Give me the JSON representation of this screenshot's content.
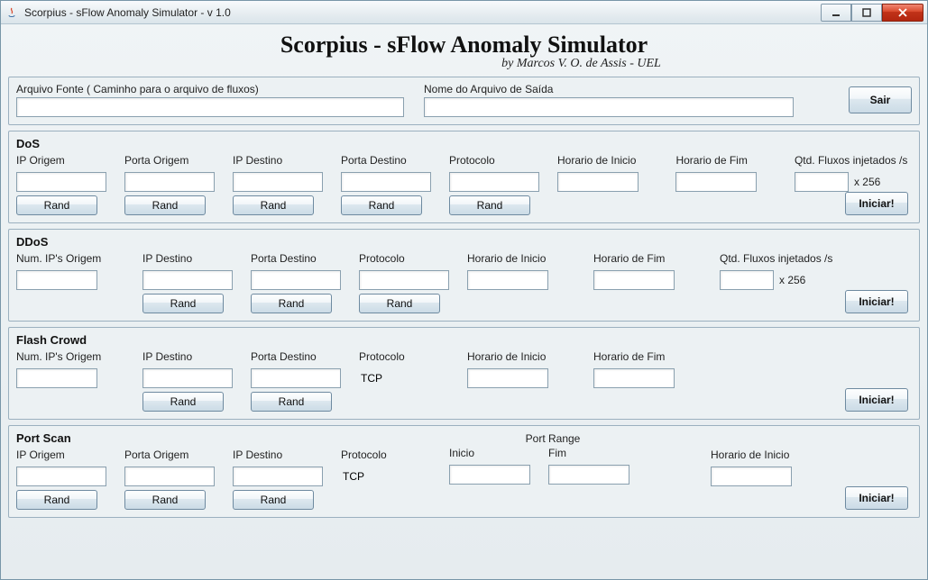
{
  "window": {
    "title": "Scorpius - sFlow Anomaly Simulator - v 1.0"
  },
  "header": {
    "title": "Scorpius - sFlow Anomaly Simulator",
    "byline": "by Marcos V. O. de Assis - UEL"
  },
  "file": {
    "sourceLabel": "Arquivo Fonte ( Caminho para o arquivo de fluxos)",
    "sourceValue": "",
    "outputLabel": "Nome do Arquivo de Saída",
    "outputValue": "",
    "exitBtn": "Sair"
  },
  "buttons": {
    "rand": "Rand",
    "iniciar": "Iniciar!"
  },
  "labels": {
    "ipOrigem": "IP Origem",
    "portaOrigem": "Porta Origem",
    "ipDestino": "IP Destino",
    "portaDestino": "Porta Destino",
    "protocolo": "Protocolo",
    "horarioInicio": "Horario de Inicio",
    "horarioFim": "Horario de Fim",
    "qtdFluxos": "Qtd. Fluxos injetados /s",
    "x256": "x 256",
    "numIpsOrigem": "Num. IP's Origem",
    "inicio": "Inicio",
    "fim": "Fim",
    "portRange": "Port Range"
  },
  "sections": {
    "dos": {
      "title": "DoS",
      "ipOrigem": "",
      "portaOrigem": "",
      "ipDestino": "",
      "portaDestino": "",
      "protocolo": "",
      "horarioInicio": "",
      "horarioFim": "",
      "qtdFluxos": ""
    },
    "ddos": {
      "title": "DDoS",
      "numIps": "",
      "ipDestino": "",
      "portaDestino": "",
      "protocolo": "",
      "horarioInicio": "",
      "horarioFim": "",
      "qtdFluxos": ""
    },
    "flash": {
      "title": "Flash Crowd",
      "numIps": "",
      "ipDestino": "",
      "portaDestino": "",
      "protocolo": "TCP",
      "horarioInicio": "",
      "horarioFim": ""
    },
    "portscan": {
      "title": "Port Scan",
      "ipOrigem": "",
      "portaOrigem": "",
      "ipDestino": "",
      "protocolo": "TCP",
      "inicio": "",
      "fim": "",
      "horarioInicio": ""
    }
  }
}
